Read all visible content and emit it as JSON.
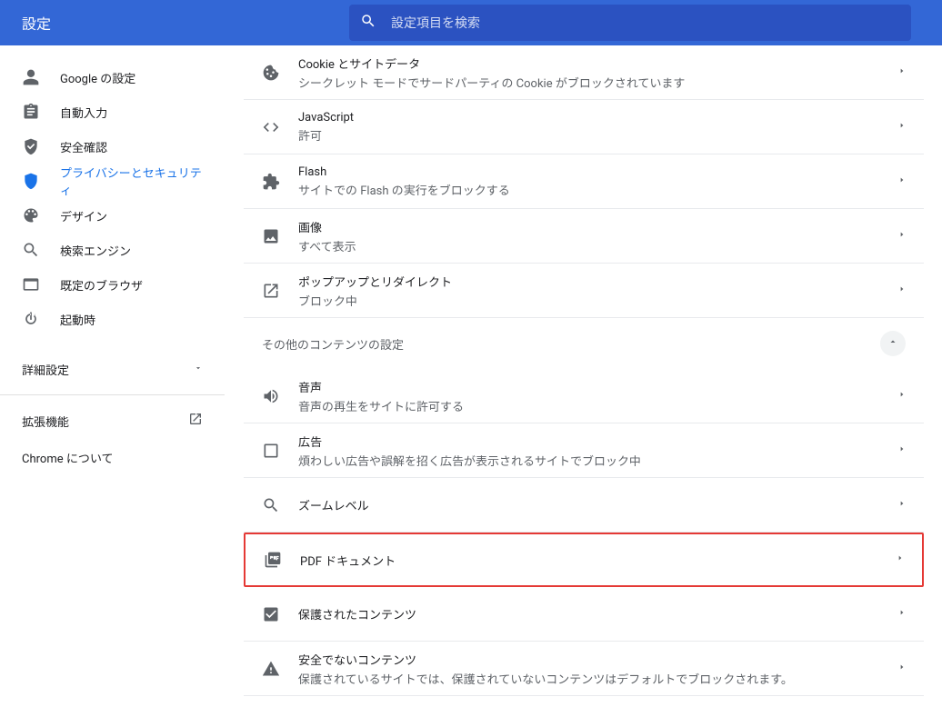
{
  "header": {
    "title": "設定",
    "search_placeholder": "設定項目を検索"
  },
  "sidebar": {
    "items": [
      {
        "label": "Google の設定",
        "icon": "person"
      },
      {
        "label": "自動入力",
        "icon": "clipboard"
      },
      {
        "label": "安全確認",
        "icon": "shield-check"
      },
      {
        "label": "プライバシーとセキュリティ",
        "icon": "shield",
        "active": true
      },
      {
        "label": "デザイン",
        "icon": "palette"
      },
      {
        "label": "検索エンジン",
        "icon": "search"
      },
      {
        "label": "既定のブラウザ",
        "icon": "browser"
      },
      {
        "label": "起動時",
        "icon": "power"
      }
    ],
    "advanced_label": "詳細設定",
    "extensions_label": "拡張機能",
    "about_label": "Chrome について"
  },
  "content": {
    "rows_a": [
      {
        "icon": "cookie",
        "title": "Cookie とサイトデータ",
        "sub": "シークレット モードでサードパーティの Cookie がブロックされています"
      },
      {
        "icon": "code",
        "title": "JavaScript",
        "sub": "許可"
      },
      {
        "icon": "puzzle",
        "title": "Flash",
        "sub": "サイトでの Flash の実行をブロックする"
      },
      {
        "icon": "image",
        "title": "画像",
        "sub": "すべて表示"
      },
      {
        "icon": "popup",
        "title": "ポップアップとリダイレクト",
        "sub": "ブロック中"
      }
    ],
    "section_title": "その他のコンテンツの設定",
    "rows_b": [
      {
        "icon": "volume",
        "title": "音声",
        "sub": "音声の再生をサイトに許可する"
      },
      {
        "icon": "frame",
        "title": "広告",
        "sub": "煩わしい広告や誤解を招く広告が表示されるサイトでブロック中"
      },
      {
        "icon": "search",
        "title": "ズームレベル",
        "sub": ""
      },
      {
        "icon": "pdf",
        "title": "PDF ドキュメント",
        "sub": "",
        "highlight": true
      },
      {
        "icon": "protected",
        "title": "保護されたコンテンツ",
        "sub": ""
      },
      {
        "icon": "warning",
        "title": "安全でないコンテンツ",
        "sub": "保護されているサイトでは、保護されていないコンテンツはデフォルトでブロックされます。"
      }
    ]
  }
}
